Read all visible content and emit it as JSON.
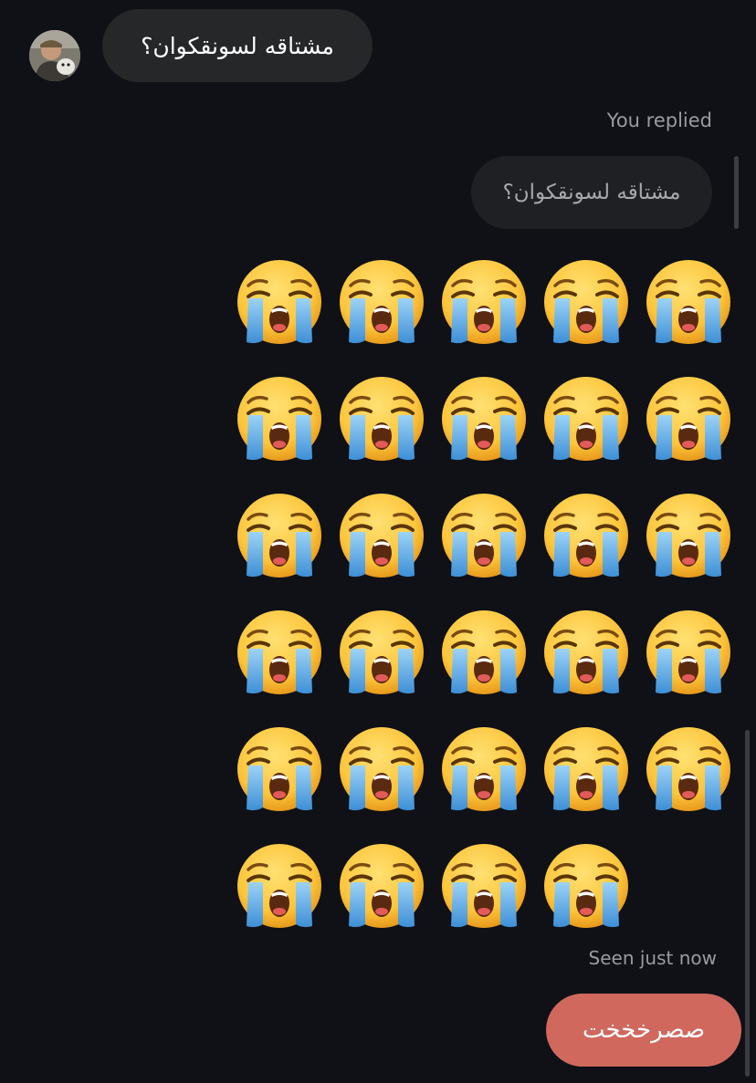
{
  "incoming": {
    "avatar_icon": "user-avatar",
    "text": "مشتاقه لسونقكوان؟"
  },
  "reply": {
    "label": "You replied",
    "quoted_text": "مشتاقه لسونقكوان؟"
  },
  "emoji_message": {
    "emoji": "loudly-crying-face",
    "count": 29,
    "per_row": 5
  },
  "status": {
    "seen": "Seen just now"
  },
  "outgoing": {
    "text": "صصرخخخت"
  },
  "colors": {
    "background": "#0f1116",
    "incoming_bubble": "#262729",
    "quoted_bubble": "#1f2023",
    "outgoing_bubble": "#d0685e"
  }
}
